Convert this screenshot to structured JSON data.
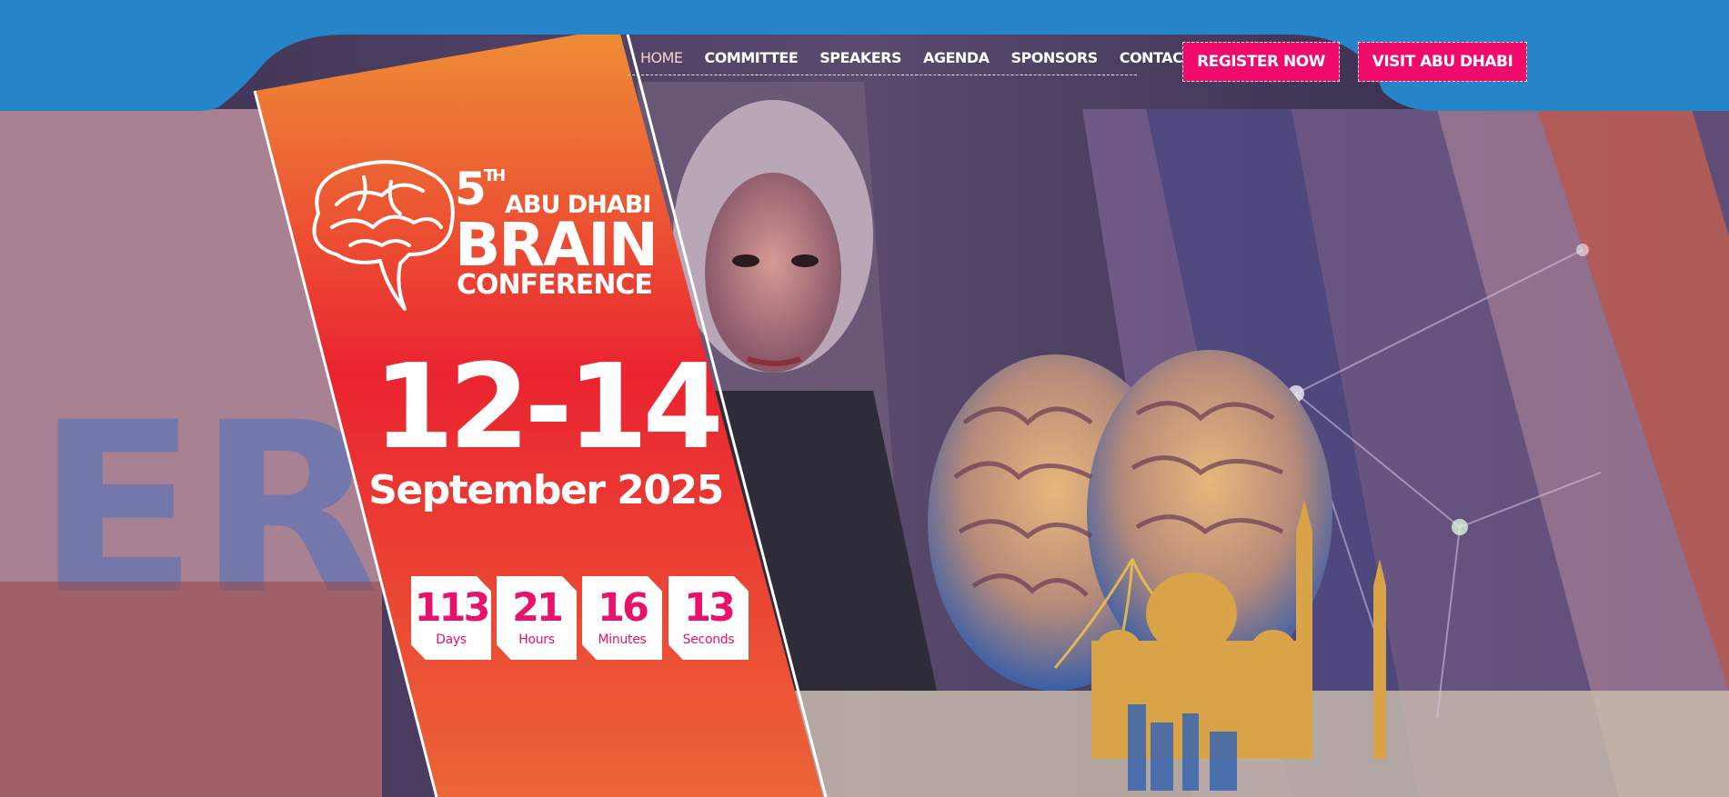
{
  "colors": {
    "top_bar_blue": "#2685c9",
    "banner_orange_top": "#ee8f35",
    "banner_red": "#ea2430",
    "accent_pink": "#ef0a6c",
    "white": "#ffffff"
  },
  "nav": {
    "items": [
      {
        "label": "HOME",
        "active": true
      },
      {
        "label": "COMMITTEE"
      },
      {
        "label": "SPEAKERS"
      },
      {
        "label": "AGENDA"
      },
      {
        "label": "SPONSORS"
      },
      {
        "label": "CONTACT"
      }
    ]
  },
  "cta": {
    "register": "REGISTER NOW",
    "visit": "VISIT ABU DHABI"
  },
  "logo": {
    "icon": "brain-outline-icon",
    "edition": "5",
    "edition_suffix": "TH",
    "city": "ABU DHABI",
    "brand": "BRAIN",
    "subtitle": "CONFERENCE"
  },
  "event": {
    "dates": "12-14",
    "month_year": "September 2025"
  },
  "countdown": [
    {
      "value": "113",
      "label": "Days"
    },
    {
      "value": "21",
      "label": "Hours"
    },
    {
      "value": "16",
      "label": "Minutes"
    },
    {
      "value": "13",
      "label": "Seconds"
    }
  ],
  "hero": {
    "illustration_icon": "brain-mosque-illustration-icon"
  }
}
